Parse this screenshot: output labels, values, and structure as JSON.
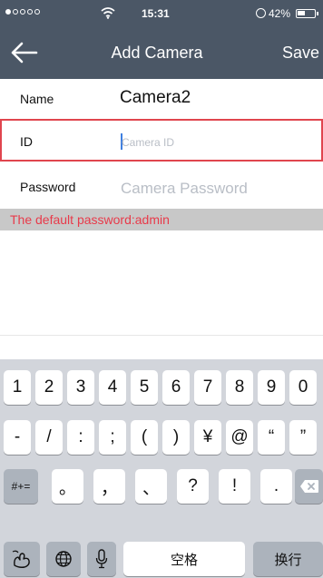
{
  "status_bar": {
    "time": "15:31",
    "battery_percent": "42%",
    "battery_level": 0.42,
    "signal_dots_filled": 1,
    "signal_dots_total": 5
  },
  "nav": {
    "title": "Add Camera",
    "save_label": "Save",
    "back_icon": "arrow-left-icon"
  },
  "form": {
    "name_label": "Name",
    "name_value": "Camera2",
    "id_label": "ID",
    "id_placeholder": "Camera ID",
    "password_label": "Password",
    "password_placeholder": "Camera Password",
    "hint": "The default password:admin"
  },
  "keyboard": {
    "row1": [
      "1",
      "2",
      "3",
      "4",
      "5",
      "6",
      "7",
      "8",
      "9",
      "0"
    ],
    "row2": [
      "-",
      "/",
      ":",
      ";",
      "(",
      ")",
      "¥",
      "@",
      "“",
      "”"
    ],
    "row3": {
      "mode": "#+=",
      "keys": [
        "。",
        "，",
        "、",
        "?",
        "!",
        "."
      ],
      "delete_icon": "backspace-icon"
    },
    "row4": {
      "handwriting_icon": "handwriting-icon",
      "globe_icon": "globe-icon",
      "mic_icon": "microphone-icon",
      "space": "空格",
      "return": "换行"
    }
  },
  "colors": {
    "nav_background": "#4b5766",
    "highlight_border": "#e0454e",
    "hint_text": "#e83a4a",
    "hint_background": "#c8c8c8",
    "keyboard_background": "#d2d5db",
    "caret": "#3f7fe0"
  }
}
